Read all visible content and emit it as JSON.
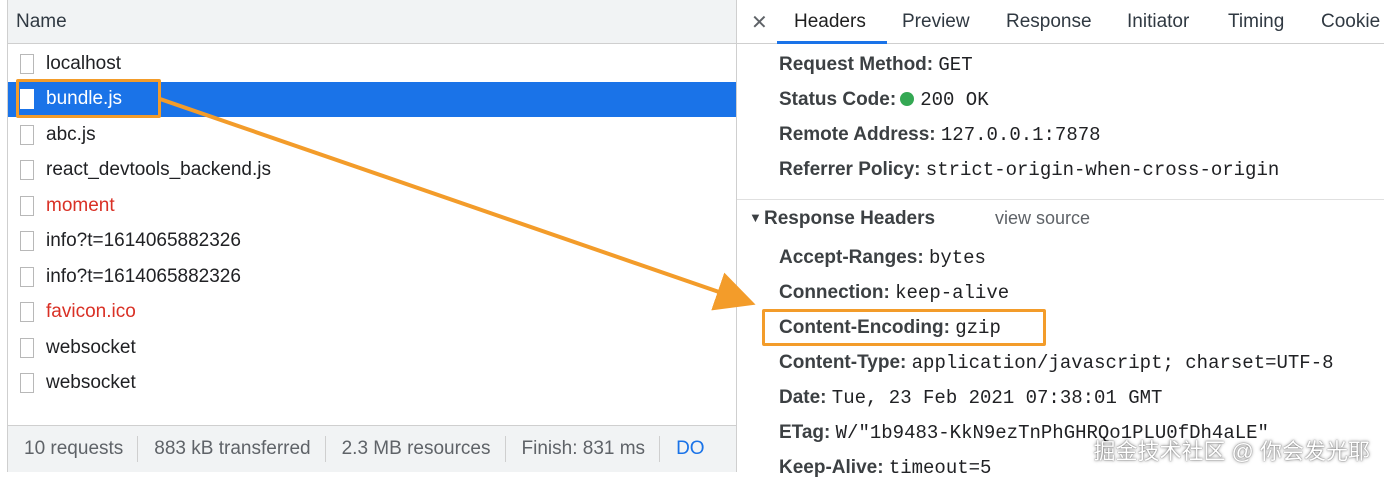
{
  "left_panel": {
    "header": "Name",
    "requests": [
      {
        "name": "localhost",
        "state": "normal"
      },
      {
        "name": "bundle.js",
        "state": "selected"
      },
      {
        "name": "abc.js",
        "state": "normal"
      },
      {
        "name": "react_devtools_backend.js",
        "state": "normal"
      },
      {
        "name": "moment",
        "state": "error"
      },
      {
        "name": "info?t=1614065882326",
        "state": "normal"
      },
      {
        "name": "info?t=1614065882326",
        "state": "normal"
      },
      {
        "name": "favicon.ico",
        "state": "error"
      },
      {
        "name": "websocket",
        "state": "normal"
      },
      {
        "name": "websocket",
        "state": "normal"
      }
    ],
    "status_bar": {
      "requests": "10 requests",
      "transferred": "883 kB transferred",
      "resources": "2.3 MB resources",
      "finish": "Finish: 831 ms",
      "dom": "DO"
    }
  },
  "right_panel": {
    "close_icon": "close-icon",
    "tabs": [
      "Headers",
      "Preview",
      "Response",
      "Initiator",
      "Timing",
      "Cookie"
    ],
    "active_tab": "Headers",
    "general": {
      "request_method": {
        "key": "Request Method:",
        "value": "GET"
      },
      "status_code": {
        "key": "Status Code:",
        "value": "200 OK",
        "dot_color": "#34a853"
      },
      "remote_address": {
        "key": "Remote Address:",
        "value": "127.0.0.1:7878"
      },
      "referrer_policy": {
        "key": "Referrer Policy:",
        "value": "strict-origin-when-cross-origin"
      }
    },
    "response_headers": {
      "title": "Response Headers",
      "view_source": "view source",
      "items": {
        "accept_ranges": {
          "key": "Accept-Ranges:",
          "value": "bytes"
        },
        "connection": {
          "key": "Connection:",
          "value": "keep-alive"
        },
        "content_encoding": {
          "key": "Content-Encoding:",
          "value": "gzip"
        },
        "content_type": {
          "key": "Content-Type:",
          "value": "application/javascript; charset=UTF-8"
        },
        "date": {
          "key": "Date:",
          "value": "Tue, 23 Feb 2021 07:38:01 GMT"
        },
        "etag": {
          "key": "ETag:",
          "value": "W/\"1b9483-KkN9ezTnPhGHRQo1PLU0fDh4aLE\""
        },
        "keep_alive": {
          "key": "Keep-Alive:",
          "value": "timeout=5"
        }
      }
    }
  },
  "annotation": {
    "highlight_color": "#f39c2a"
  },
  "watermark": "掘金技术社区 @ 你会发光耶",
  "colors": {
    "selected_row": "#1a73e8",
    "error_text": "#d93025",
    "active_tab_underline": "#1a73e8"
  }
}
